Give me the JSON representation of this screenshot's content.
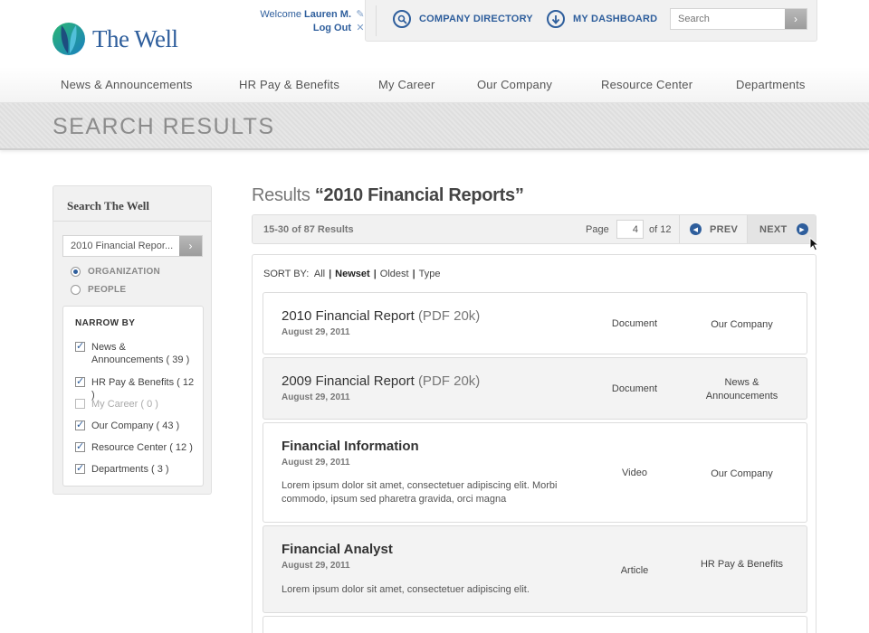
{
  "brand": {
    "name": "The Well"
  },
  "user": {
    "welcome": "Welcome",
    "name": "Lauren M.",
    "logout": "Log Out"
  },
  "topbar": {
    "company_directory": "COMPANY DIRECTORY",
    "my_dashboard": "MY DASHBOARD",
    "search_placeholder": "Search"
  },
  "nav": {
    "items": [
      "News & Announcements",
      "HR Pay & Benefits",
      "My Career",
      "Our Company",
      "Resource Center",
      "Departments"
    ]
  },
  "banner": {
    "title": "SEARCH RESULTS"
  },
  "sidebar": {
    "title": "Search The Well",
    "search_value": "2010 Financial Repor...",
    "scope": [
      {
        "label": "ORGANIZATION",
        "selected": true
      },
      {
        "label": "PEOPLE",
        "selected": false
      }
    ],
    "narrow_title": "NARROW BY",
    "facets": [
      {
        "label": "News & Announcements ( 39 )",
        "checked": true,
        "disabled": false
      },
      {
        "label": "HR Pay & Benefits ( 12 )",
        "checked": true,
        "disabled": false
      },
      {
        "label": "My Career ( 0 )",
        "checked": false,
        "disabled": true
      },
      {
        "label": "Our Company ( 43 )",
        "checked": true,
        "disabled": false
      },
      {
        "label": "Resource Center ( 12 )",
        "checked": true,
        "disabled": false
      },
      {
        "label": "Departments ( 3 )",
        "checked": true,
        "disabled": false
      }
    ]
  },
  "results": {
    "heading_prefix": "Results",
    "query": "“2010 Financial Reports”",
    "count": "15-30 of 87 Results",
    "page_label": "Page",
    "page_value": "4",
    "page_of": "of 12",
    "prev": "PREV",
    "next": "NEXT"
  },
  "sort": {
    "label": "SORT BY:",
    "options": [
      {
        "label": "All",
        "active": false
      },
      {
        "label": "Newset",
        "active": true
      },
      {
        "label": "Oldest",
        "active": false
      },
      {
        "label": "Type",
        "active": false
      }
    ]
  },
  "items": [
    {
      "title": "2010 Financial Report",
      "meta": "(PDF 20k)",
      "date": "August 29, 2011",
      "desc": "",
      "type": "Document",
      "category": "Our Company"
    },
    {
      "title": "2009 Financial Report",
      "meta": "(PDF 20k)",
      "date": "August 29, 2011",
      "desc": "",
      "type": "Document",
      "category": "News & Announcements"
    },
    {
      "title": "Financial Information",
      "meta": "",
      "date": "August 29, 2011",
      "desc": "Lorem ipsum dolor sit amet, consectetuer adipiscing elit. Morbi commodo, ipsum sed pharetra gravida, orci magna",
      "type": "Video",
      "category": "Our Company"
    },
    {
      "title": "Financial Analyst",
      "meta": "",
      "date": "August 29, 2011",
      "desc": "Lorem ipsum dolor sit amet, consectetuer adipiscing elit.",
      "type": "Article",
      "category": "HR Pay & Benefits"
    }
  ],
  "colors": {
    "accent": "#2e5e9c",
    "banner": "#dedede"
  },
  "icons": {
    "logo": "leaf-logo-icon",
    "edit": "pencil-icon",
    "logout": "close-icon",
    "directory": "magnifier-icon",
    "dashboard": "arrow-down-circle-icon",
    "search": "chevron-right-icon",
    "prev": "triangle-left-icon",
    "next": "triangle-right-icon"
  }
}
